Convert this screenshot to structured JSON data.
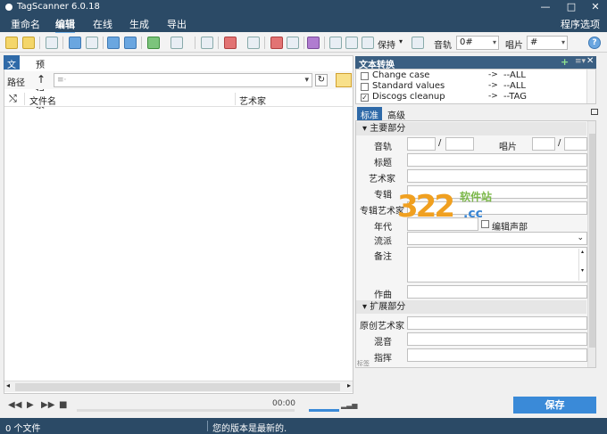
{
  "window": {
    "title": "TagScanner 6.0.18",
    "min": "—",
    "max": "□",
    "close": "✕"
  },
  "menu": {
    "items": [
      "重命名",
      "编辑",
      "在线",
      "生成",
      "导出"
    ],
    "active": "编辑",
    "right": "程序选项",
    "help": "?"
  },
  "toolbar": {
    "keep_label": "保持",
    "track_label": "音轨",
    "track_value": "0#",
    "disc_label": "唱片",
    "disc_value": "#"
  },
  "left": {
    "tabs": [
      "文件",
      "预览记录"
    ],
    "path_label": "路径",
    "path_placeholder": "≡·",
    "columns": [
      "文件名",
      "艺术家"
    ]
  },
  "player": {
    "time": "00:00"
  },
  "text_convert": {
    "title": "文本转换",
    "rows": [
      {
        "checked": false,
        "name": "Change case",
        "arrow": "->",
        "value": "--ALL"
      },
      {
        "checked": false,
        "name": "Standard values",
        "arrow": "->",
        "value": "--ALL"
      },
      {
        "checked": true,
        "name": "Discogs cleanup",
        "arrow": "->",
        "value": "--TAG"
      }
    ]
  },
  "tag_editor": {
    "tabs": [
      "标准",
      "高级"
    ],
    "section_main": "主要部分",
    "track": "音轨",
    "disc": "唱片",
    "title": "标题",
    "artist": "艺术家",
    "album": "专辑",
    "album_artist": "专辑艺术家",
    "year": "年代",
    "compilation": "编辑声部",
    "genre": "流派",
    "comment": "备注",
    "composer": "作曲",
    "section_ext": "扩展部分",
    "orig_artist": "原创艺术家",
    "remixer": "混音",
    "conductor": "指挥",
    "footer": "标签"
  },
  "save_label": "保存",
  "status": {
    "files": "0 个文件",
    "message": "您的版本是最新的."
  },
  "watermark": {
    "num": "322",
    "sub": "软件站",
    "cc": ".cc"
  }
}
